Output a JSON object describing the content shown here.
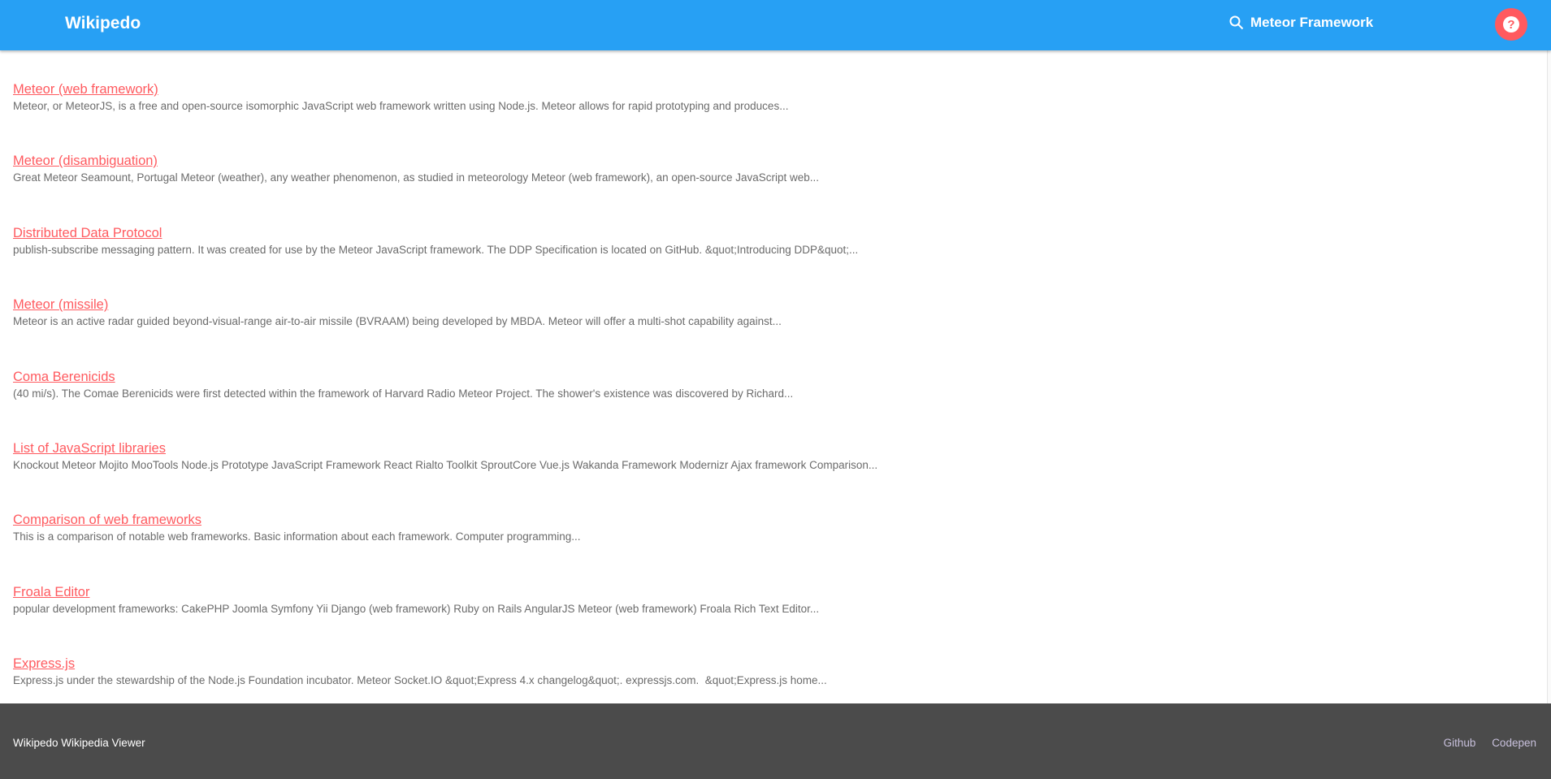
{
  "header": {
    "title": "Wikipedo",
    "search_query": "Meteor Framework",
    "search_icon": "search-icon",
    "help_icon": "question-circle-icon",
    "help_color": "#ff5a5f",
    "bar_color": "#27a0f4"
  },
  "results": [
    {
      "title": "Meteor (web framework)",
      "snippet": "Meteor, or MeteorJS, is a free and open-source isomorphic JavaScript web framework written using Node.js. Meteor allows for rapid prototyping and produces..."
    },
    {
      "title": "Meteor (disambiguation)",
      "snippet": "Great Meteor Seamount, Portugal Meteor (weather), any weather phenomenon, as studied in meteorology Meteor (web framework), an open-source JavaScript web..."
    },
    {
      "title": "Distributed Data Protocol",
      "snippet": "publish-subscribe messaging pattern. It was created for use by the Meteor JavaScript framework. The DDP Specification is located on GitHub. &quot;Introducing DDP&quot;..."
    },
    {
      "title": "Meteor (missile)",
      "snippet": "Meteor is an active radar guided beyond-visual-range air-to-air missile (BVRAAM) being developed by MBDA. Meteor will offer a multi-shot capability against..."
    },
    {
      "title": "Coma Berenicids",
      "snippet": "(40 mi/s). The Comae Berenicids were first detected within the framework of Harvard Radio Meteor Project. The shower's existence was discovered by Richard..."
    },
    {
      "title": "List of JavaScript libraries",
      "snippet": "Knockout Meteor Mojito MooTools Node.js Prototype JavaScript Framework React Rialto Toolkit SproutCore Vue.js Wakanda Framework Modernizr Ajax framework Comparison..."
    },
    {
      "title": "Comparison of web frameworks",
      "snippet": "This is a comparison of notable web frameworks. Basic information about each framework. Computer programming..."
    },
    {
      "title": "Froala Editor",
      "snippet": "popular development frameworks: CakePHP Joomla Symfony Yii Django (web framework) Ruby on Rails AngularJS Meteor (web framework) Froala Rich Text Editor..."
    },
    {
      "title": "Express.js",
      "snippet": "Express.js under the stewardship of the Node.js Foundation incubator. Meteor Socket.IO &quot;Express 4.x changelog&quot;. expressjs.com.  &quot;Express.js home..."
    }
  ],
  "footer": {
    "text": "Wikipedo Wikipedia Viewer",
    "links": [
      "Github",
      "Codepen"
    ]
  }
}
